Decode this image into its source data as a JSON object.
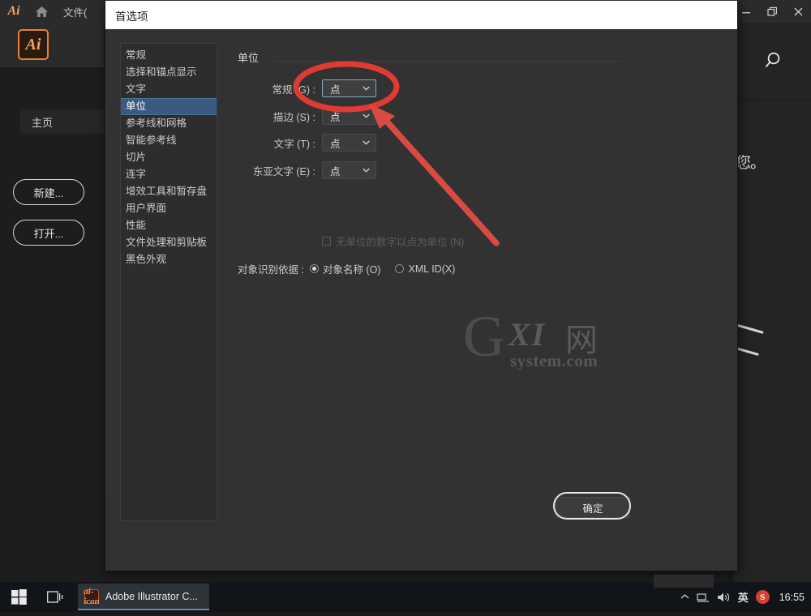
{
  "app": {
    "logo": "Ai",
    "home_icon": "home-icon",
    "menu_file": "文件(",
    "window_controls": {
      "minimize": "minimize-icon",
      "restore": "restore-icon",
      "close": "close-icon"
    },
    "home_tab": "主页",
    "buttons": {
      "new": "新建...",
      "open": "打开..."
    },
    "right_panel": {
      "search_icon": "search-icon",
      "partial_text": "您。"
    }
  },
  "dialog": {
    "title": "首选项",
    "categories": [
      {
        "label": "常规",
        "selected": false
      },
      {
        "label": "选择和锚点显示",
        "selected": false
      },
      {
        "label": "文字",
        "selected": false
      },
      {
        "label": "单位",
        "selected": true
      },
      {
        "label": "参考线和网格",
        "selected": false
      },
      {
        "label": "智能参考线",
        "selected": false
      },
      {
        "label": "切片",
        "selected": false
      },
      {
        "label": "连字",
        "selected": false
      },
      {
        "label": "增效工具和暂存盘",
        "selected": false
      },
      {
        "label": "用户界面",
        "selected": false
      },
      {
        "label": "性能",
        "selected": false
      },
      {
        "label": "文件处理和剪贴板",
        "selected": false
      },
      {
        "label": "黑色外观",
        "selected": false
      }
    ],
    "pane": {
      "heading": "单位",
      "fields": [
        {
          "label": "常规 (G) :",
          "value": "点",
          "focused": true
        },
        {
          "label": "描边 (S) :",
          "value": "点",
          "focused": false
        },
        {
          "label": "文字 (T) :",
          "value": "点",
          "focused": false
        },
        {
          "label": "东亚文字 (E) :",
          "value": "点",
          "focused": false
        }
      ],
      "checkbox": {
        "label": "无单位的数字以点为单位 (N)",
        "checked": false,
        "disabled": true
      },
      "radio_group": {
        "label": "对象识别依据 :",
        "options": [
          {
            "label": "对象名称 (O)",
            "checked": true
          },
          {
            "label": "XML ID(X)",
            "checked": false
          }
        ]
      }
    },
    "ok_button": "确定"
  },
  "watermark": {
    "g": "G",
    "xi": "XI",
    "net": "网",
    "sub": "system.com"
  },
  "taskbar": {
    "start_icon": "windows-start-icon",
    "taskview_icon": "task-view-icon",
    "app": {
      "icon": "ai-icon",
      "label": "Adobe Illustrator C..."
    },
    "tray": {
      "chevron": "chevron-up-icon",
      "network_icon": "network-icon",
      "volume_icon": "volume-icon",
      "ime": "英",
      "sogou_icon": "S",
      "clock": "16:55"
    }
  },
  "colors": {
    "accent_blue": "#3a5a80",
    "annotation_red": "#e03a35",
    "ai_orange": "#e8803a",
    "dialog_bg": "#323232",
    "titlebar_white": "#ffffff"
  }
}
